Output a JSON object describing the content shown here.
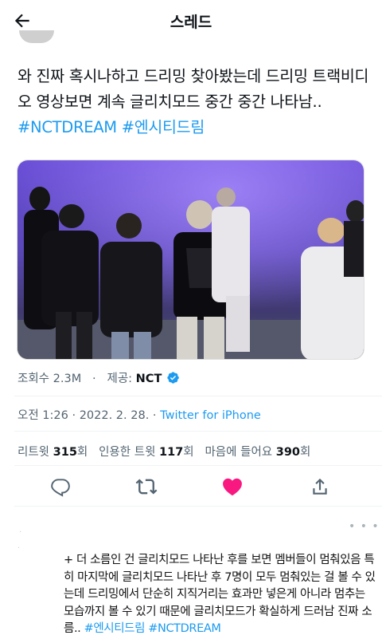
{
  "header": {
    "title": "스레드"
  },
  "tweet": {
    "text": "와 진짜 혹시나하고 드리밍 찾아봤는데 드리밍 트랙비디오 영상보면 계속 글리치모드 중간 중간 나타남.. ",
    "hashtag1": "#NCTDREAM",
    "hashtag2": "#엔시티드림"
  },
  "stats": {
    "views_label": "조회수",
    "views_value": "2.3M",
    "separator": "·",
    "provided_label": "제공:",
    "provider": "NCT"
  },
  "timestamp": {
    "time": "오전 1:26",
    "date": "2022. 2. 28.",
    "source": "Twitter for iPhone"
  },
  "engagement": {
    "retweets_label": "리트윗",
    "retweets_value": "315",
    "retweets_unit": "회",
    "quotes_label": "인용한 트윗",
    "quotes_value": "117",
    "quotes_unit": "회",
    "likes_label": "마음에 들어요",
    "likes_value": "390",
    "likes_unit": "회"
  },
  "actions": {
    "like_color": "#f91880"
  },
  "comment": {
    "text": "+ 더 소름인 건 글리치모드 나타난 후를 보면 멤버들이 멈춰있음 특히 마지막에 글리치모드 나타난 후 7명이 모두 멈춰있는 걸 볼 수 있는데 드리밍에서 단순히 지직거리는 효과만 넣은게 아니라 멈추는 모습까지 볼 수 있기 때문에 글리치모드가 확실하게 드러남 진짜 소름.. ",
    "hashtag1": "#엔시티드림",
    "hashtag2": "#NCTDREAM"
  },
  "colors": {
    "link": "#1d9bf0",
    "verified": "#1d9bf0",
    "secondary_text": "#536471"
  }
}
